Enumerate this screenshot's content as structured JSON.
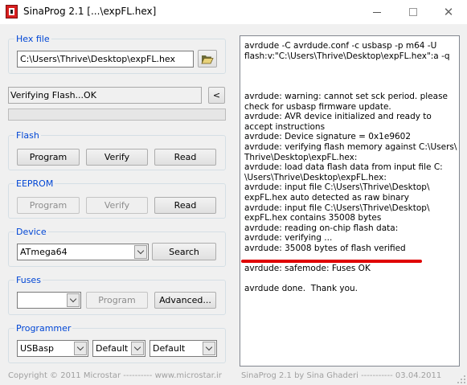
{
  "window": {
    "title": "SinaProg 2.1 [...\\expFL.hex]",
    "minimize_icon": "minimize-icon",
    "maximize_icon": "maximize-icon",
    "close_glyph": "✕"
  },
  "hexfile": {
    "legend": "Hex file",
    "path": "C:\\Users\\Thrive\\Desktop\\expFL.hex",
    "open_icon": "folder-open-icon"
  },
  "status": {
    "text": "Verifying Flash...OK",
    "toggle_label": "<",
    "progress_percent": 0
  },
  "flash": {
    "legend": "Flash",
    "program": "Program",
    "verify": "Verify",
    "read": "Read"
  },
  "eeprom": {
    "legend": "EEPROM",
    "program": "Program",
    "verify": "Verify",
    "read": "Read"
  },
  "device": {
    "legend": "Device",
    "selected": "ATmega64",
    "search": "Search"
  },
  "fuses": {
    "legend": "Fuses",
    "selected": "",
    "program": "Program",
    "advanced": "Advanced..."
  },
  "programmer": {
    "legend": "Programmer",
    "selected": "USBasp",
    "port": "Default",
    "speed": "Default"
  },
  "log": {
    "lines": [
      "avrdude -C avrdude.conf -c usbasp -p m64 -U",
      "flash:v:\"C:\\Users\\Thrive\\Desktop\\expFL.hex\":a -q",
      "",
      "",
      "",
      "avrdude: warning: cannot set sck period. please",
      "check for usbasp firmware update.",
      "avrdude: AVR device initialized and ready to",
      "accept instructions",
      "avrdude: Device signature = 0x1e9602",
      "avrdude: verifying flash memory against C:\\Users\\",
      "Thrive\\Desktop\\expFL.hex:",
      "avrdude: load data flash data from input file C:",
      "\\Users\\Thrive\\Desktop\\expFL.hex:",
      "avrdude: input file C:\\Users\\Thrive\\Desktop\\",
      "expFL.hex auto detected as raw binary",
      "avrdude: input file C:\\Users\\Thrive\\Desktop\\",
      "expFL.hex contains 35008 bytes",
      "avrdude: reading on-chip flash data:",
      "avrdude: verifying ...",
      "avrdude: 35008 bytes of flash verified",
      "",
      "avrdude: safemode: Fuses OK",
      "",
      "avrdude done.  Thank you."
    ],
    "highlight_color": "#e00000"
  },
  "footer": {
    "left": "Copyright © 2011 Microstar  ----------   www.microstar.ir",
    "right": "SinaProg 2.1  by  Sina Ghaderi  -----------   03.04.2011"
  },
  "colors": {
    "legend": "#0046d5",
    "window_bg": "#f0f0f0"
  }
}
